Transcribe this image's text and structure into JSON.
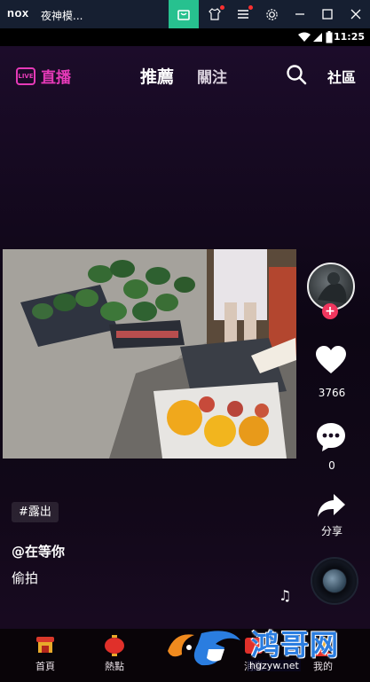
{
  "window": {
    "logo": "nox",
    "title": "夜神模..."
  },
  "status": {
    "time": "11:25"
  },
  "topnav": {
    "live_label": "直播",
    "live_badge": "LIVE",
    "tab_recommended": "推薦",
    "tab_following": "關注",
    "community": "社區"
  },
  "side": {
    "like_count": "3766",
    "comment_count": "0",
    "share_label": "分享"
  },
  "post": {
    "hashtag": "#露出",
    "author": "@在等你",
    "caption": "偷拍"
  },
  "bottomnav": {
    "items": [
      {
        "label": "首頁",
        "icon": "home-lantern-icon"
      },
      {
        "label": "熱點",
        "icon": "hot-lantern-icon"
      },
      {
        "label": "消息",
        "icon": "message-icon"
      },
      {
        "label": "我的",
        "icon": "profile-icon"
      }
    ]
  },
  "watermark": {
    "brand": "鸿哥网",
    "url": "hgzyw.net"
  },
  "colors": {
    "accent_pink": "#e63ab8",
    "follow_red": "#f0365e",
    "titlebar": "#161f31",
    "shop_green": "#27c18f"
  }
}
